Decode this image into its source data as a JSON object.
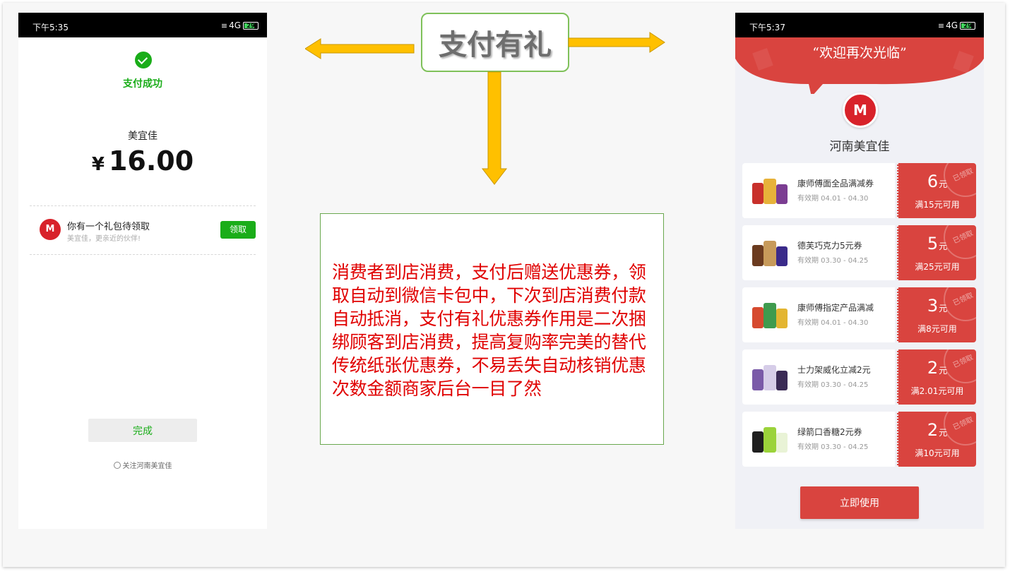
{
  "slide_title": "支付有礼",
  "description": "消费者到店消费，支付后赠送优惠券，领取自动到微信卡包中，下次到店消费付款自动抵消，支付有礼优惠券作用是二次捆绑顾客到店消费，提高复购率完美的替代传统纸张优惠券，不易丢失自动核销优惠次数金额商家后台一目了然",
  "colors": {
    "wechat_green": "#1aad19",
    "coupon_red": "#d9443f",
    "arrow_yellow": "#ffc000",
    "desc_red": "#e00000"
  },
  "left_phone": {
    "status": {
      "time": "下午5:35",
      "network": "4G",
      "battery": "29"
    },
    "pay_success": "支付成功",
    "merchant": "美宜佳",
    "currency": "¥",
    "amount": "16.00",
    "gift": {
      "logo_text": "M",
      "title": "你有一个礼包待领取",
      "subtitle": "美宜佳，更亲近的伙伴!",
      "claim_label": "领取"
    },
    "done_label": "完成",
    "follow_label": "关注河南美宜佳"
  },
  "right_phone": {
    "status": {
      "time": "下午5:37",
      "network": "4G",
      "battery": "29"
    },
    "welcome": "“欢迎再次光临”",
    "logo_text": "M",
    "store_name": "河南美宜佳",
    "claimed_label": "已领取",
    "currency_unit": "元",
    "coupons": [
      {
        "name": "康师傅面全品满减券",
        "valid": "有效期 04.01 - 04.30",
        "amount": "6",
        "condition": "满15元可用"
      },
      {
        "name": "德芙巧克力5元券",
        "valid": "有效期 03.30 - 04.25",
        "amount": "5",
        "condition": "满25元可用"
      },
      {
        "name": "康师傅指定产品满减",
        "valid": "有效期 04.01 - 04.30",
        "amount": "3",
        "condition": "满8元可用"
      },
      {
        "name": "士力架威化立减2元",
        "valid": "有效期 03.30 - 04.25",
        "amount": "2",
        "condition": "满2.01元可用"
      },
      {
        "name": "绿箭口香糖2元券",
        "valid": "有效期 03.30 - 04.25",
        "amount": "2",
        "condition": "满10元可用"
      }
    ],
    "use_label": "立即使用"
  }
}
